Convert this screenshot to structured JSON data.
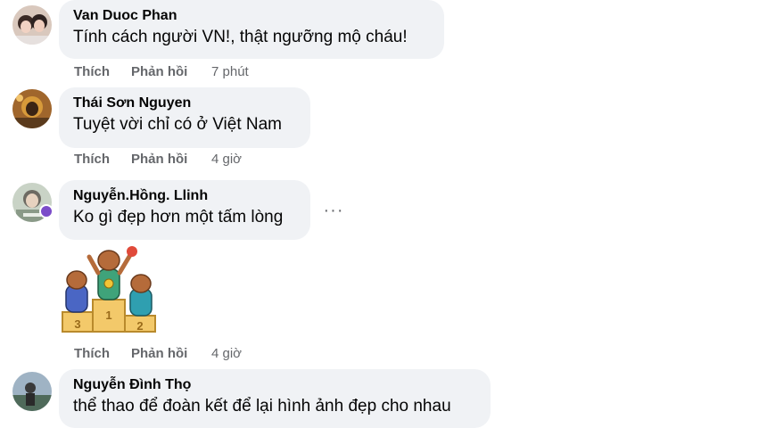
{
  "comments": [
    {
      "author": "Van Duoc Phan",
      "text": "Tính cách người VN!, thật ngưỡng mộ cháu!",
      "like": "Thích",
      "reply": "Phản hồi",
      "time": "7 phút"
    },
    {
      "author": "Thái Sơn Nguyen",
      "text": "Tuyệt vời chỉ có ở Việt Nam",
      "like": "Thích",
      "reply": "Phản hồi",
      "time": "4 giờ"
    },
    {
      "author": "Nguyễn.Hồng. Llinh",
      "text": "Ko gì đẹp hơn một tấm lòng",
      "like": "Thích",
      "reply": "Phản hồi",
      "time": "4 giờ",
      "more": "···"
    },
    {
      "author": "Nguyễn Đình Thọ",
      "text": "thể thao để đoàn kết để lại hình ảnh đẹp cho nhau"
    }
  ],
  "sticker": {
    "first": "1",
    "second": "2",
    "third": "3"
  },
  "colors": {
    "bubble": "#f0f2f5",
    "meta": "#65676b",
    "text": "#050505"
  }
}
